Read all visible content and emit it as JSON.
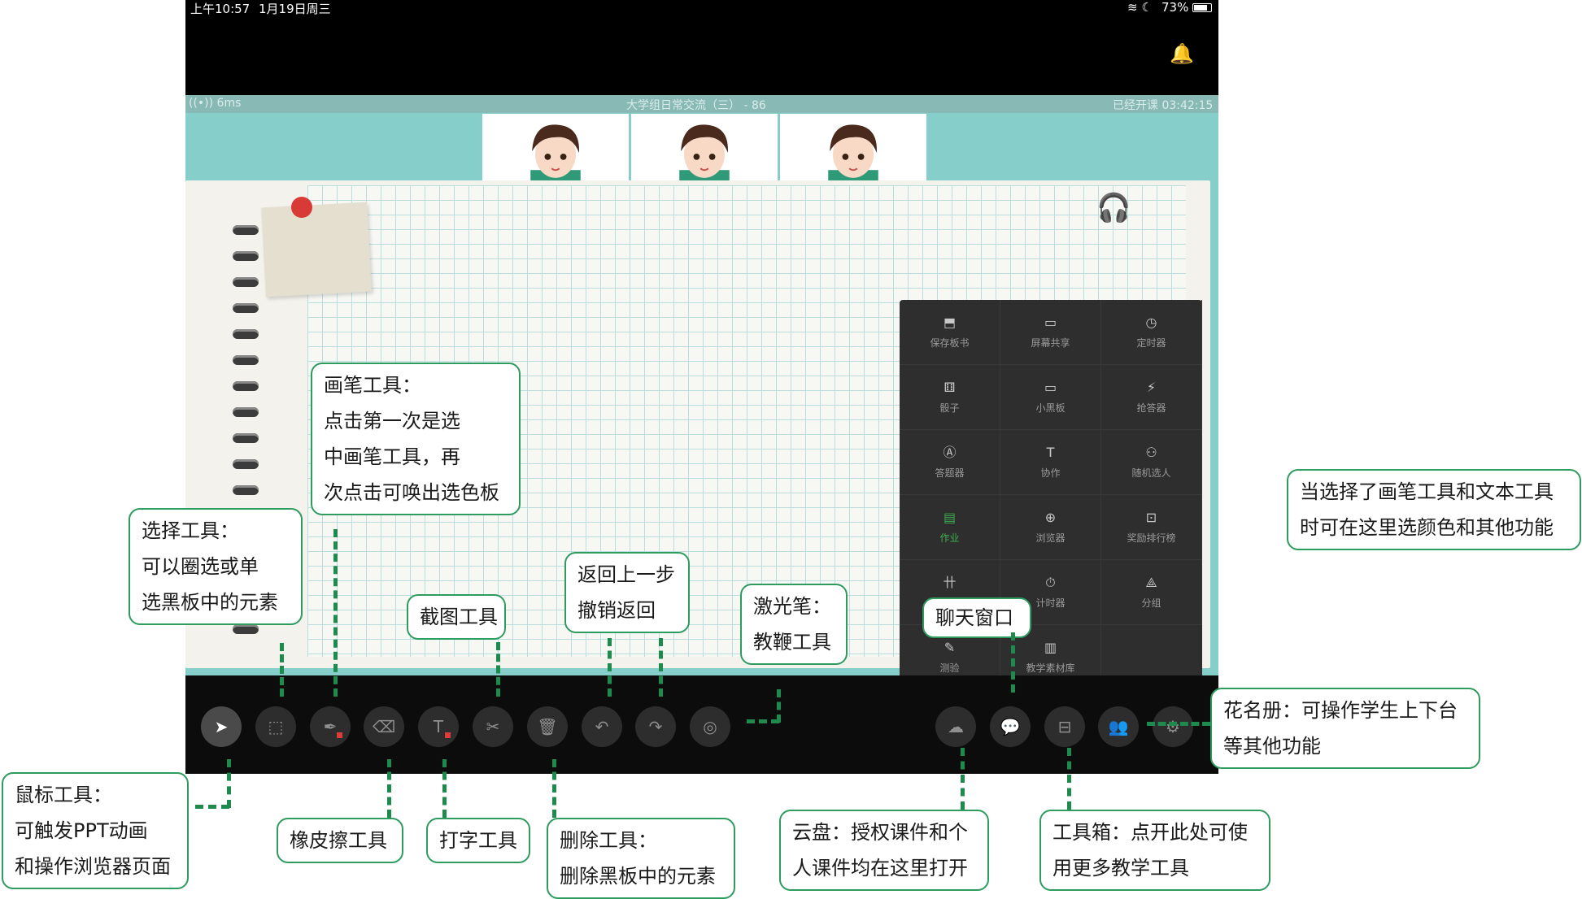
{
  "status_bar": {
    "time": "上午10:57",
    "date": "1月19日周三",
    "battery": "73%"
  },
  "info_bar": {
    "signal": "((•)) 6ms",
    "title": "大学组日常交流（三） - 86",
    "elapsed": "已经开课 03:42:15"
  },
  "toolbox": [
    {
      "label": "保存板书",
      "icon": "save-icon",
      "glyph": "⬒"
    },
    {
      "label": "屏幕共享",
      "icon": "screen-share-icon",
      "glyph": "▭"
    },
    {
      "label": "定时器",
      "icon": "timer-icon",
      "glyph": "◷"
    },
    {
      "label": "骰子",
      "icon": "dice-icon",
      "glyph": "⚅"
    },
    {
      "label": "小黑板",
      "icon": "blackboard-icon",
      "glyph": "▭"
    },
    {
      "label": "抢答器",
      "icon": "buzzer-icon",
      "glyph": "⚡"
    },
    {
      "label": "答题器",
      "icon": "answer-icon",
      "glyph": "Ⓐ"
    },
    {
      "label": "协作",
      "icon": "collaborate-icon",
      "glyph": "T"
    },
    {
      "label": "随机选人",
      "icon": "random-pick-icon",
      "glyph": "⚇"
    },
    {
      "label": "作业",
      "icon": "homework-icon",
      "glyph": "▤"
    },
    {
      "label": "浏览器",
      "icon": "browser-icon",
      "glyph": "⊕"
    },
    {
      "label": "奖励排行榜",
      "icon": "leaderboard-icon",
      "glyph": "⊡"
    },
    {
      "label": "",
      "icon": "grid-table-icon",
      "glyph": "卄"
    },
    {
      "label": "计时器",
      "icon": "stopwatch-icon",
      "glyph": "⏱"
    },
    {
      "label": "分组",
      "icon": "group-icon",
      "glyph": "⟁"
    },
    {
      "label": "测验",
      "icon": "quiz-icon",
      "glyph": "✎"
    },
    {
      "label": "教学素材库",
      "icon": "material-library-icon",
      "glyph": "▥"
    }
  ],
  "toolbar": [
    {
      "name": "mouse-tool",
      "icon": "cursor-icon",
      "glyph": "➤"
    },
    {
      "name": "select-tool",
      "icon": "marquee-icon",
      "glyph": "⬚"
    },
    {
      "name": "pen-tool",
      "icon": "pen-icon",
      "glyph": "✒"
    },
    {
      "name": "eraser-tool",
      "icon": "eraser-icon",
      "glyph": "⌫"
    },
    {
      "name": "text-tool",
      "icon": "text-icon",
      "glyph": "T"
    },
    {
      "name": "screenshot-tool",
      "icon": "scissors-icon",
      "glyph": "✂"
    },
    {
      "name": "delete-tool",
      "icon": "trash-icon",
      "glyph": "🗑"
    },
    {
      "name": "undo-tool",
      "icon": "undo-icon",
      "glyph": "↶"
    },
    {
      "name": "redo-tool",
      "icon": "redo-icon",
      "glyph": "↷"
    },
    {
      "name": "laser-tool",
      "icon": "laser-icon",
      "glyph": "◎"
    },
    {
      "name": "cloud-disk-tool",
      "icon": "cloud-icon",
      "glyph": "☁"
    },
    {
      "name": "chat-tool",
      "icon": "chat-icon",
      "glyph": "💬"
    },
    {
      "name": "toolbox-tool",
      "icon": "toolbox-icon",
      "glyph": "⊟"
    },
    {
      "name": "roster-tool",
      "icon": "users-icon",
      "glyph": "👥"
    },
    {
      "name": "settings-tool",
      "icon": "gear-icon",
      "glyph": "⚙"
    }
  ],
  "callouts": {
    "pen": [
      "画笔工具：",
      "点击第一次是选",
      "中画笔工具，再",
      "次点击可唤出选色板"
    ],
    "select": [
      "选择工具：",
      "可以圈选或单",
      "选黑板中的元素"
    ],
    "screenshot": [
      "截图工具"
    ],
    "undo": [
      "返回上一步",
      "撤销返回"
    ],
    "laser": [
      "激光笔：",
      "教鞭工具"
    ],
    "chat": [
      "聊天窗口"
    ],
    "color": [
      "当选择了画笔工具和文本工具",
      "时可在这里选颜色和其他功能"
    ],
    "roster": [
      "花名册：可操作学生上下台",
      "等其他功能"
    ],
    "mouse": [
      "鼠标工具：",
      "可触发PPT动画",
      "和操作浏览器页面"
    ],
    "eraser": [
      "橡皮擦工具"
    ],
    "text": [
      "打字工具"
    ],
    "delete": [
      "删除工具：",
      "删除黑板中的元素"
    ],
    "cloud": [
      "云盘：授权课件和个",
      "人课件均在这里打开"
    ],
    "toolbox": [
      "工具箱：点开此处可使",
      "用更多教学工具"
    ]
  }
}
